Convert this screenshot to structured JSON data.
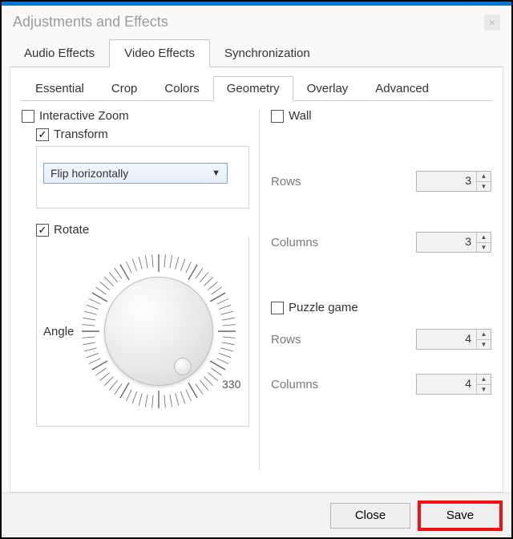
{
  "window": {
    "title": "Adjustments and Effects"
  },
  "tabs_main": {
    "items": [
      "Audio Effects",
      "Video Effects",
      "Synchronization"
    ],
    "active_index": 1
  },
  "tabs_sub": {
    "items": [
      "Essential",
      "Crop",
      "Colors",
      "Geometry",
      "Overlay",
      "Advanced"
    ],
    "active_index": 3
  },
  "geometry": {
    "interactive_zoom": {
      "label": "Interactive Zoom",
      "checked": false
    },
    "transform": {
      "label": "Transform",
      "checked": true,
      "selected": "Flip horizontally"
    },
    "rotate": {
      "label": "Rotate",
      "checked": true,
      "angle_label": "Angle",
      "end_tick": "330"
    },
    "wall": {
      "label": "Wall",
      "checked": false,
      "rows_label": "Rows",
      "rows": 3,
      "cols_label": "Columns",
      "cols": 3
    },
    "puzzle": {
      "label": "Puzzle game",
      "checked": false,
      "rows_label": "Rows",
      "rows": 4,
      "cols_label": "Columns",
      "cols": 4
    }
  },
  "footer": {
    "close": "Close",
    "save": "Save"
  }
}
